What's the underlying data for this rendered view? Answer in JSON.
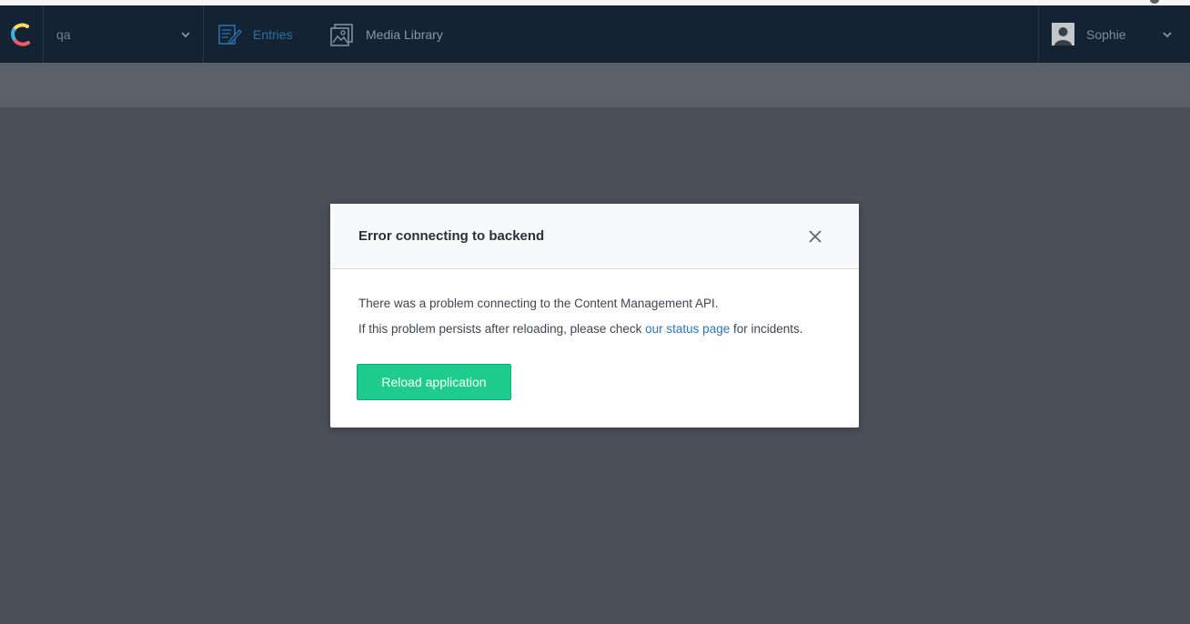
{
  "header": {
    "space_name": "qa",
    "nav": {
      "entries_label": "Entries",
      "media_label": "Media Library"
    },
    "user": {
      "name": "Sophie"
    }
  },
  "modal": {
    "title": "Error connecting to backend",
    "line1": "There was a problem connecting to the Content Management API.",
    "line2_before": "If this problem persists after reloading, please check ",
    "line2_link": "our status page",
    "line2_after": " for incidents.",
    "reload_label": "Reload application"
  },
  "colors": {
    "topbar": "#132333",
    "overlay": "#4a4f58",
    "primary_button": "#1ecc8f",
    "link": "#2e75b5",
    "active_nav": "#2b6fa8"
  },
  "icons": {
    "logo": "contentful-logo",
    "space_chevron": "chevron-down-icon",
    "entries": "entries-icon",
    "media": "media-library-icon",
    "user_chevron": "chevron-down-icon",
    "close": "close-icon"
  }
}
